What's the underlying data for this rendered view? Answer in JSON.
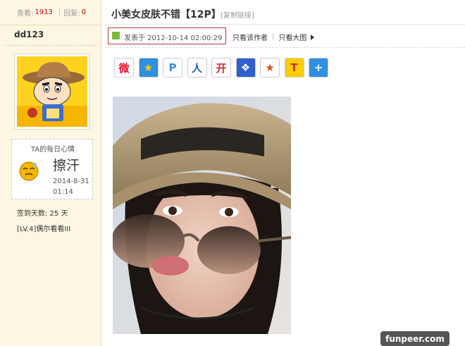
{
  "sidebar": {
    "views_label": "查看:",
    "views_count": "1913",
    "replies_label": "回复:",
    "replies_count": "0",
    "username": "dd123",
    "mood": {
      "title": "TA的每日心情",
      "text": "擦汗",
      "date": "2014-8-31",
      "time": "01:14",
      "icon": "sweat-face-icon"
    },
    "checkin": "签到天数: 25 天",
    "level": "[LV.4]偶尔看看III"
  },
  "post": {
    "title": "小美女皮肤不错【12P】",
    "copy_link": "[复制链接]",
    "posted": "发表于 2012-10-14 02:00:29",
    "only_author": "只看该作者",
    "only_large": "只看大图"
  },
  "share_icons": [
    {
      "name": "weibo-icon",
      "glyph": "微",
      "bg": "#ffffff",
      "fg": "#e6162d"
    },
    {
      "name": "qzone-icon",
      "glyph": "★",
      "bg": "#2f8fe0",
      "fg": "#ffcc00"
    },
    {
      "name": "tencent-weibo-icon",
      "glyph": "P",
      "bg": "#ffffff",
      "fg": "#2f8fe0"
    },
    {
      "name": "renren-icon",
      "glyph": "人",
      "bg": "#ffffff",
      "fg": "#1f5fb8"
    },
    {
      "name": "kaixin-icon",
      "glyph": "开",
      "bg": "#ffffff",
      "fg": "#d3282f"
    },
    {
      "name": "baidu-icon",
      "glyph": "❖",
      "bg": "#2f5fd0",
      "fg": "#ffffff"
    },
    {
      "name": "pengyou-icon",
      "glyph": "★",
      "bg": "#ffffff",
      "fg": "#e64a19"
    },
    {
      "name": "tianya-icon",
      "glyph": "T",
      "bg": "#ffcc00",
      "fg": "#d32f2f"
    },
    {
      "name": "more-share-icon",
      "glyph": "+",
      "bg": "#2f8fe0",
      "fg": "#ffffff"
    }
  ],
  "watermark": "funpeer.com"
}
